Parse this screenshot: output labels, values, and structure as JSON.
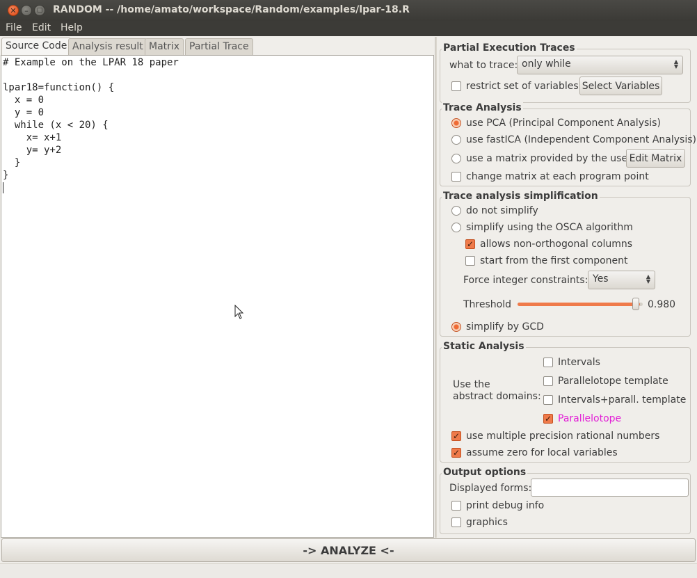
{
  "window": {
    "title": "RANDOM -- /home/amato/workspace/Random/examples/lpar-18.R",
    "close_glyph": "✕",
    "minimize_glyph": "–",
    "maximize_glyph": "▢"
  },
  "menu": [
    "File",
    "Edit",
    "Help"
  ],
  "tabs": [
    "Source Code",
    "Analysis result",
    "Matrix",
    "Partial Trace"
  ],
  "source_code": "# Example on the LPAR 18 paper\n\nlpar18=function() {\n  x = 0\n  y = 0\n  while (x < 20) {\n    x= x+1\n    y= y+2\n  }\n}",
  "partial_execution": {
    "title": "Partial Execution Traces",
    "what_to_trace_label": "what to trace:",
    "what_to_trace_value": "only while",
    "restrict_label": "restrict set of variables",
    "restrict_checked": false,
    "select_variables_button": "Select Variables"
  },
  "trace_analysis": {
    "title": "Trace Analysis",
    "options": [
      {
        "label": "use PCA (Principal Component Analysis)",
        "selected": true
      },
      {
        "label": "use fastICA (Independent Component Analysis)",
        "selected": false
      },
      {
        "label": "use a matrix provided by the user",
        "selected": false
      }
    ],
    "edit_matrix_button": "Edit Matrix",
    "change_matrix_label": "change matrix at each program point",
    "change_matrix_checked": false
  },
  "simplification": {
    "title": "Trace analysis simplification",
    "do_not_simplify": "do not simplify",
    "osca": "simplify using the OSCA algorithm",
    "non_orthogonal": "allows non-orthogonal columns",
    "non_orthogonal_checked": true,
    "first_component": "start from the first component",
    "first_component_checked": false,
    "force_integer_label": "Force integer constraints:",
    "force_integer_value": "Yes",
    "threshold_label": "Threshold",
    "threshold_value": "0.980",
    "threshold_fraction": 0.98,
    "gcd": "simplify by GCD",
    "selected": "gcd"
  },
  "static_analysis": {
    "title": "Static Analysis",
    "domains_label_1": "Use the",
    "domains_label_2": "abstract domains:",
    "domains": [
      {
        "label": "Intervals",
        "checked": false
      },
      {
        "label": "Parallelotope template",
        "checked": false
      },
      {
        "label": "Intervals+parall. template",
        "checked": false
      },
      {
        "label": "Parallelotope",
        "checked": true
      }
    ],
    "highlight_color": "#e21ed6",
    "mp_rational": "use multiple precision rational numbers",
    "mp_rational_checked": true,
    "zero_locals": "assume zero for local variables",
    "zero_locals_checked": true
  },
  "output_options": {
    "title": "Output options",
    "displayed_forms_label": "Displayed forms:",
    "displayed_forms_value": "",
    "debug_label": "print debug info",
    "debug_checked": false,
    "graphics_label": "graphics",
    "graphics_checked": false
  },
  "analyze_button": "-> ANALYZE <-",
  "colors": {
    "accent": "#ef7a4a",
    "titlebar": "#3c3b37",
    "panel": "#f0eeea"
  }
}
